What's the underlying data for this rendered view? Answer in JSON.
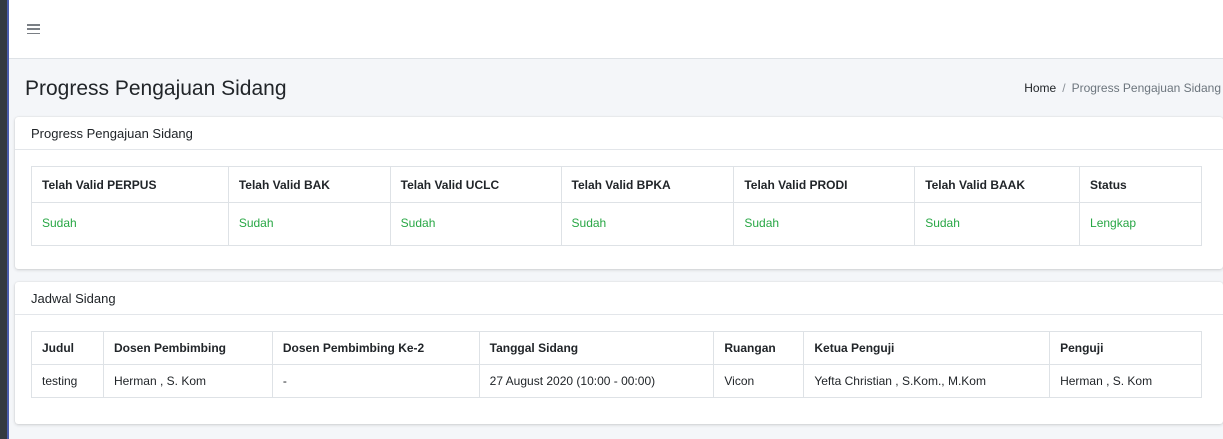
{
  "page": {
    "title": "Progress Pengajuan Sidang"
  },
  "breadcrumb": {
    "home": "Home",
    "separator": "/",
    "current": "Progress Pengajuan Sidang"
  },
  "progress_card": {
    "title": "Progress Pengajuan Sidang",
    "headers": [
      "Telah Valid PERPUS",
      "Telah Valid BAK",
      "Telah Valid UCLC",
      "Telah Valid BPKA",
      "Telah Valid PRODI",
      "Telah Valid BAAK",
      "Status"
    ],
    "row": [
      "Sudah",
      "Sudah",
      "Sudah",
      "Sudah",
      "Sudah",
      "Sudah",
      "Lengkap"
    ]
  },
  "jadwal_card": {
    "title": "Jadwal Sidang",
    "headers": [
      "Judul",
      "Dosen Pembimbing",
      "Dosen Pembimbing Ke-2",
      "Tanggal Sidang",
      "Ruangan",
      "Ketua Penguji",
      "Penguji"
    ],
    "row": [
      "testing",
      "Herman , S. Kom",
      "-",
      "27 August 2020 (10:00 - 00:00)",
      "Vicon",
      "Yefta Christian , S.Kom., M.Kom",
      "Herman , S. Kom"
    ]
  },
  "colors": {
    "valid_text": "#28a745",
    "sidebar_edge": "#343a40"
  },
  "icons": {
    "menu": "hamburger-icon"
  }
}
